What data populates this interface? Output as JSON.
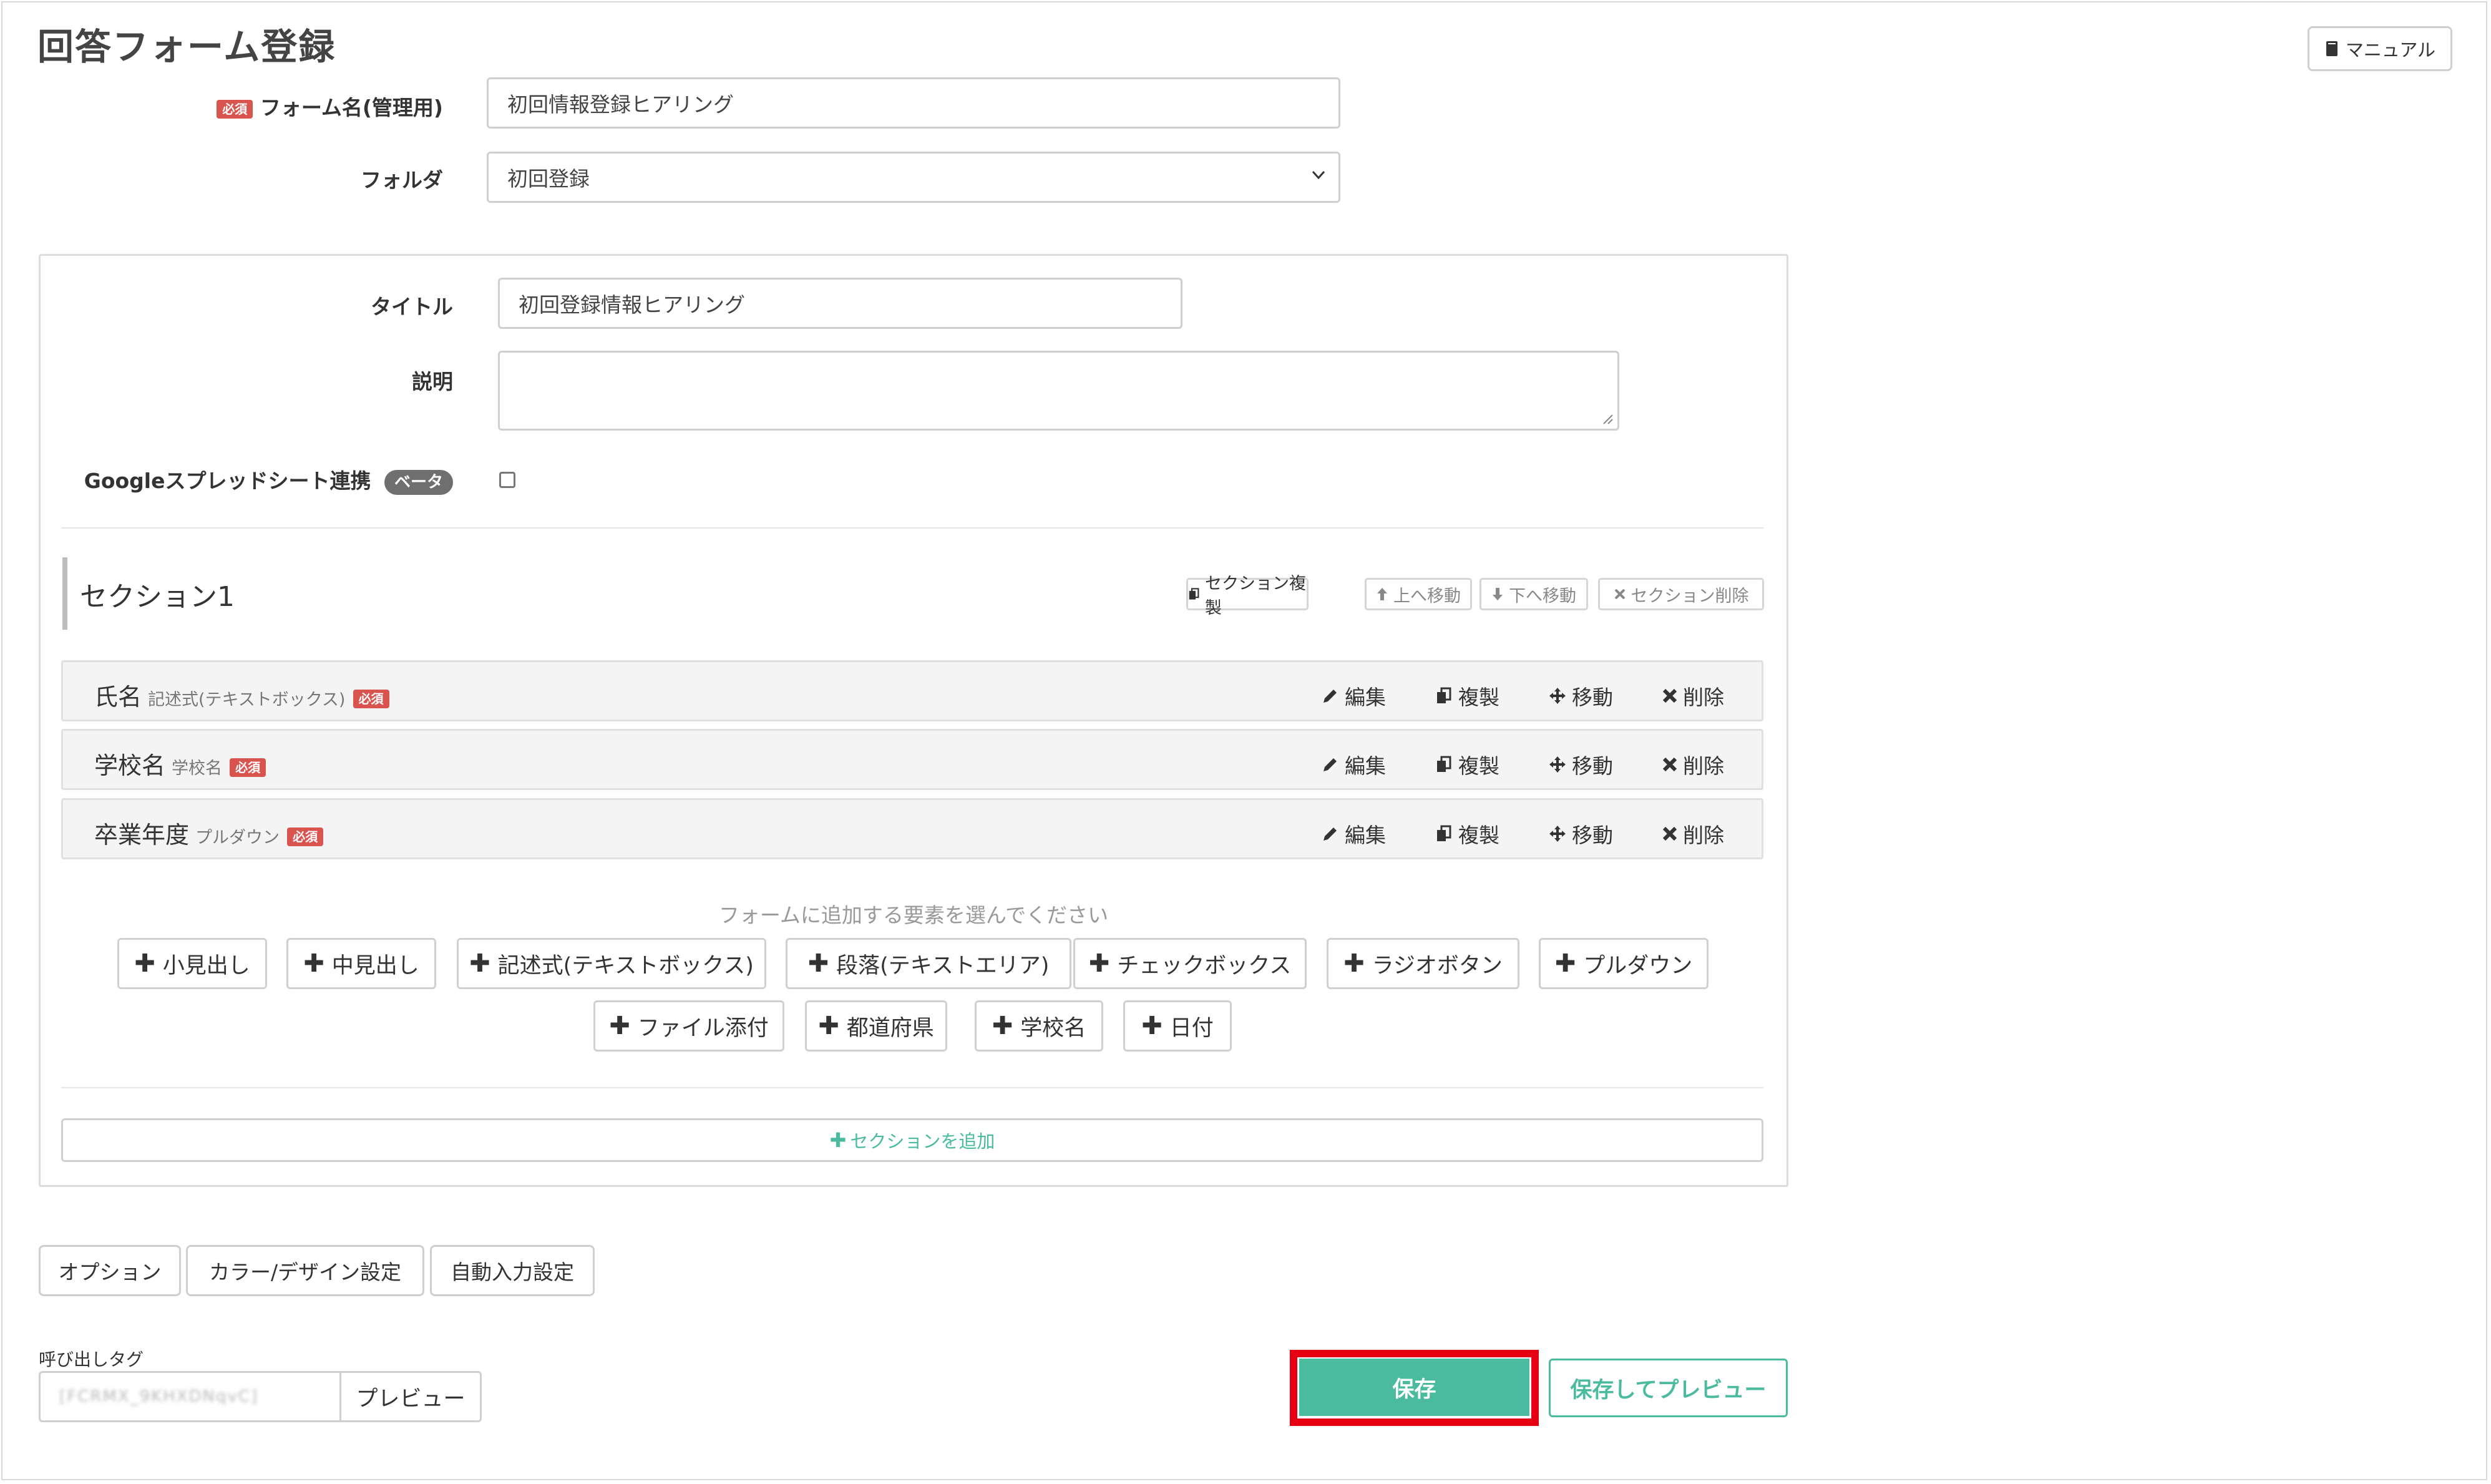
{
  "header": {
    "title": "回答フォーム登録",
    "manual_label": "マニュアル"
  },
  "form_meta": {
    "required_badge": "必須",
    "form_name_label": "フォーム名(管理用)",
    "form_name_value": "初回情報登録ヒアリング",
    "folder_label": "フォルダ",
    "folder_value": "初回登録"
  },
  "settings": {
    "title_label": "タイトル",
    "title_value": "初回登録情報ヒアリング",
    "description_label": "説明",
    "description_value": "",
    "google_label": "Googleスプレッドシート連携",
    "beta_badge": "ベータ",
    "google_checked": false
  },
  "section": {
    "title": "セクション1",
    "buttons": {
      "copy": "セクション複製",
      "up": "上へ移動",
      "down": "下へ移動",
      "delete": "セクション削除"
    }
  },
  "items": [
    {
      "name": "氏名",
      "type": "記述式(テキストボックス)",
      "required": "必須"
    },
    {
      "name": "学校名",
      "type": "学校名",
      "required": "必須"
    },
    {
      "name": "卒業年度",
      "type": "プルダウン",
      "required": "必須"
    }
  ],
  "item_actions": {
    "edit": "編集",
    "copy": "複製",
    "move": "移動",
    "delete": "削除"
  },
  "add_elements": {
    "hint": "フォームに追加する要素を選んでください",
    "row1": [
      "小見出し",
      "中見出し",
      "記述式(テキストボックス)",
      "段落(テキストエリア)",
      "チェックボックス",
      "ラジオボタン",
      "プルダウン"
    ],
    "row2": [
      "ファイル添付",
      "都道府県",
      "学校名",
      "日付"
    ]
  },
  "add_section_label": "セクションを追加",
  "tabs": [
    "オプション",
    "カラー/デザイン設定",
    "自動入力設定"
  ],
  "call_tag": {
    "label": "呼び出しタグ",
    "value": "[FCRMX_9KHXDNqvC]",
    "preview_label": "プレビュー"
  },
  "footer": {
    "save_label": "保存",
    "save_preview_label": "保存してプレビュー"
  },
  "colors": {
    "accent": "#4bbba0",
    "required": "#d9534f",
    "highlight": "#e60012"
  }
}
